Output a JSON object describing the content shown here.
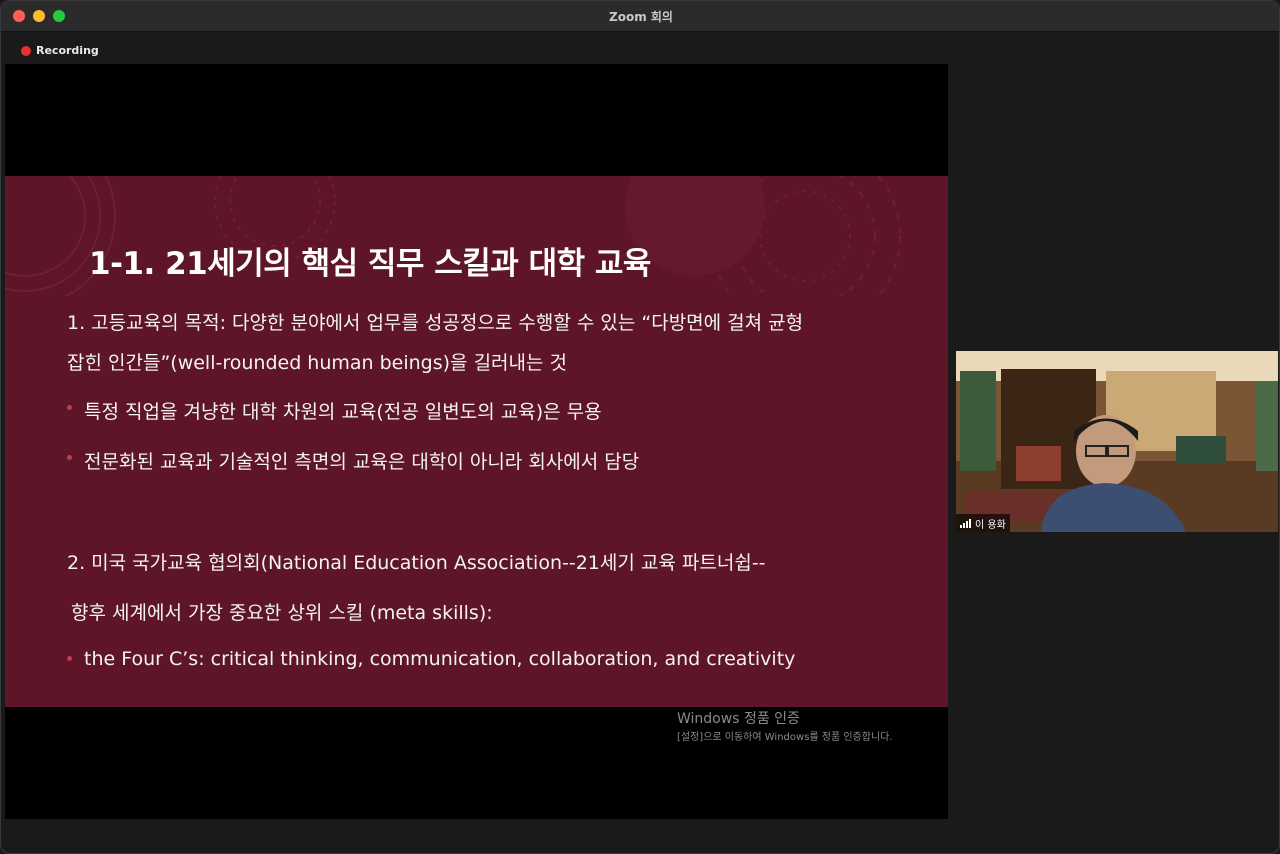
{
  "window": {
    "title": "Zoom 회의"
  },
  "recording": {
    "label": "Recording"
  },
  "slide": {
    "title": "1-1. 21세기의 핵심 직무 스킬과 대학 교육",
    "lines": [
      "1. 고등교육의 목적: 다양한 분야에서 업무를 성공정으로 수행할 수 있는 “다방면에 걸쳐 균형",
      "잡힌 인간들”(well-rounded human beings)을 길러내는 것",
      "특정 직업을 겨냥한 대학 차원의 교육(전공 일변도의 교육)은 무용",
      "전문화된 교육과 기술적인 측면의 교육은 대학이 아니라 회사에서 담당",
      "2. 미국 국가교육 협의회(National Education Association--21세기 교육 파트너쉽--",
      "향후 세계에서 가장 중요한 상위 스킬 (meta skills):",
      "the Four C’s: critical thinking, communication, collaboration, and creativity"
    ]
  },
  "activation": {
    "title": "Windows 정품 인증",
    "body": "[설정]으로 이동하여 Windows를 정품 인증합니다."
  },
  "participant": {
    "name": "이 용화"
  },
  "colors": {
    "slide_bg": "#5e1528",
    "bullet": "#c23a5a",
    "record": "#e8322f"
  }
}
